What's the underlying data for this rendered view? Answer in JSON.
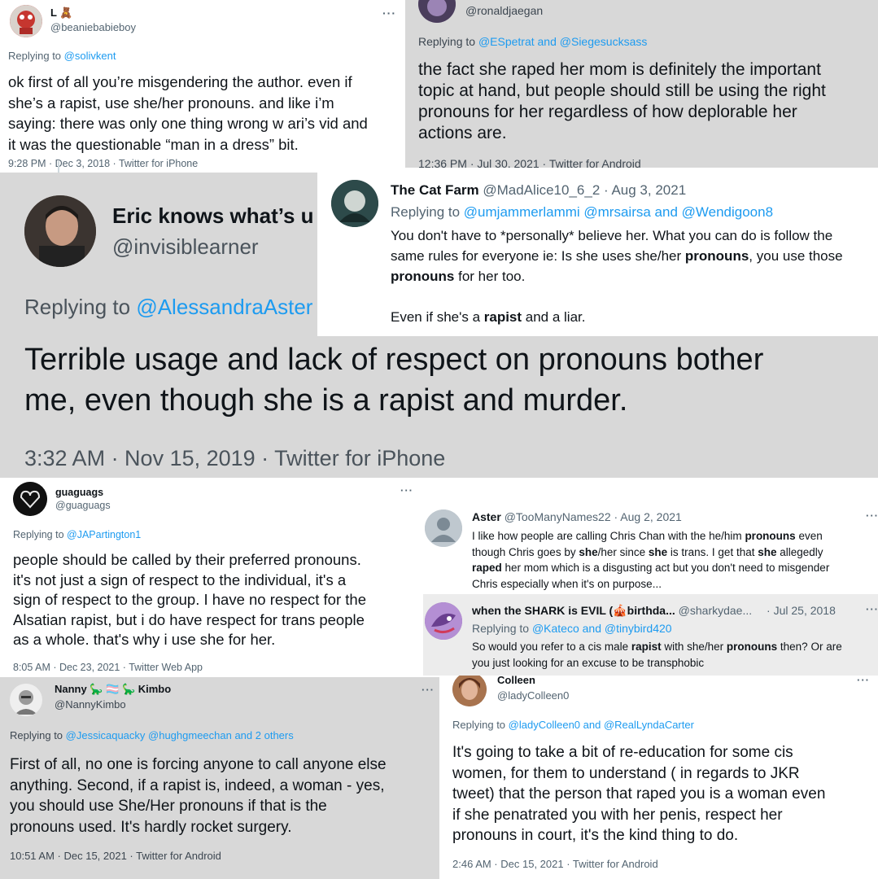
{
  "c1": {
    "name": "L 🧸",
    "handle": "@beaniebabieboy",
    "reply_prefix": "Replying to",
    "reply_to": "@solivkent",
    "lines": [
      "ok first of all you’re misgendering the author. even if",
      "she’s a rapist, use she/her pronouns. and like i’m",
      "saying: there was only one thing wrong w ari’s vid and",
      "it was the questionable “man in a dress” bit."
    ],
    "footer": "9:28 PM · Dec 3, 2018 · Twitter for iPhone",
    "more": "···"
  },
  "c2": {
    "handle": "@ronaldjaegan",
    "reply_prefix": "Replying to",
    "reply_to": "@ESpetrat and @Siegesucksass",
    "lines": [
      "the fact she raped her mom is definitely the important",
      "topic at hand, but people should still be using the right",
      "pronouns for her regardless of how deplorable her",
      "actions are."
    ],
    "footer": "12:36 PM · Jul 30, 2021 · Twitter for Android"
  },
  "c3": {
    "name": "Eric knows what’s u",
    "handle": "@invisiblearner",
    "reply_prefix": "Replying to",
    "reply_to": "@AlessandraAster",
    "lines": [
      "Terrible usage and lack of respect on pronouns bother",
      "me, even though she is a rapist and murder."
    ],
    "footer": "3:32 AM · Nov 15, 2019 · Twitter for iPhone"
  },
  "c4": {
    "name": "The Cat Farm",
    "handle": "@MadAlice10_6_2",
    "date": "· Aug 3, 2021",
    "reply_prefix": "Replying to",
    "reply_to": "@umjammerlammi @mrsairsa and @Wendigoon8",
    "line1": "You don't have to *personally* believe her. What you can do is follow the",
    "line2_a": "same rules for everyone ie: Is she uses she/her ",
    "line2_b": "pronouns",
    "line2_c": ", you use those",
    "line3_a": "pronouns",
    "line3_b": " for her too.",
    "line4_a": "Even if she's a ",
    "line4_b": "rapist",
    "line4_c": " and a liar."
  },
  "c5": {
    "name": "guaguags",
    "handle": "@guaguags",
    "reply_prefix": "Replying to",
    "reply_to": "@JAPartington1",
    "lines": [
      "people should be called by their preferred pronouns.",
      "it's not just a sign of respect to the individual, it's a",
      "sign of respect to the group. I have no respect for the",
      "Alsatian rapist, but i do have respect for trans people",
      "as a whole. that's why i use she for her."
    ],
    "footer": "8:05 AM · Dec 23, 2021 · Twitter Web App",
    "more": "···"
  },
  "c6": {
    "name": "Aster",
    "handle": "@TooManyNames22",
    "date": "· Aug 2, 2021",
    "l1_a": "I like how people are calling Chris Chan with the he/him ",
    "l1_b": "pronouns",
    "l1_c": " even",
    "l2_a": "though Chris goes by ",
    "l2_b": "she",
    "l2_c": "/her since ",
    "l2_d": "she",
    "l2_e": " is trans. I get that ",
    "l2_f": "she",
    "l2_g": " allegedly",
    "l3_a": "raped",
    "l3_b": " her mom which is a disgusting act but you don't need to misgender",
    "l4": "Chris especially when it's on purpose...",
    "more": "···"
  },
  "c7": {
    "name": "when the SHARK is EVIL (🎪birthda...",
    "handle": "@sharkydae...",
    "date": "· Jul 25, 2018",
    "reply_prefix": "Replying to",
    "reply_to": "@Kateco and @tinybird420",
    "l1_a": "So would you refer to a cis male ",
    "l1_b": "rapist",
    "l1_c": " with she/her ",
    "l1_d": "pronouns",
    "l1_e": " then? Or are",
    "l2": "you just looking for an excuse to be transphobic",
    "more": "···"
  },
  "c8": {
    "name": "Nanny 🦕 🏳️‍⚧️ 🦕 Kimbo",
    "handle": "@NannyKimbo",
    "reply_prefix": "Replying to",
    "reply_to": "@Jessicaquacky @hughgmeechan and 2 others",
    "lines": [
      "First of all, no one is forcing anyone to call anyone else",
      "anything. Second, if a rapist is, indeed, a woman - yes,",
      "you should use She/Her pronouns if that is the",
      "pronouns used. It's hardly rocket surgery."
    ],
    "footer": "10:51 AM · Dec 15, 2021 · Twitter for Android",
    "more": "···"
  },
  "c9": {
    "name": "Colleen",
    "handle": "@ladyColleen0",
    "reply_prefix": "Replying to",
    "reply_to": "@ladyColleen0 and @RealLyndaCarter",
    "lines": [
      "It's going to take a bit of re-education for some cis",
      "women, for them to understand ( in regards to JKR",
      "tweet) that the person that raped you is a woman even",
      "if she penatrated you with her penis, respect her",
      "pronouns in court, it's the kind thing to do."
    ],
    "footer": "2:46 AM · Dec 15, 2021 · Twitter for Android",
    "more": "···"
  }
}
